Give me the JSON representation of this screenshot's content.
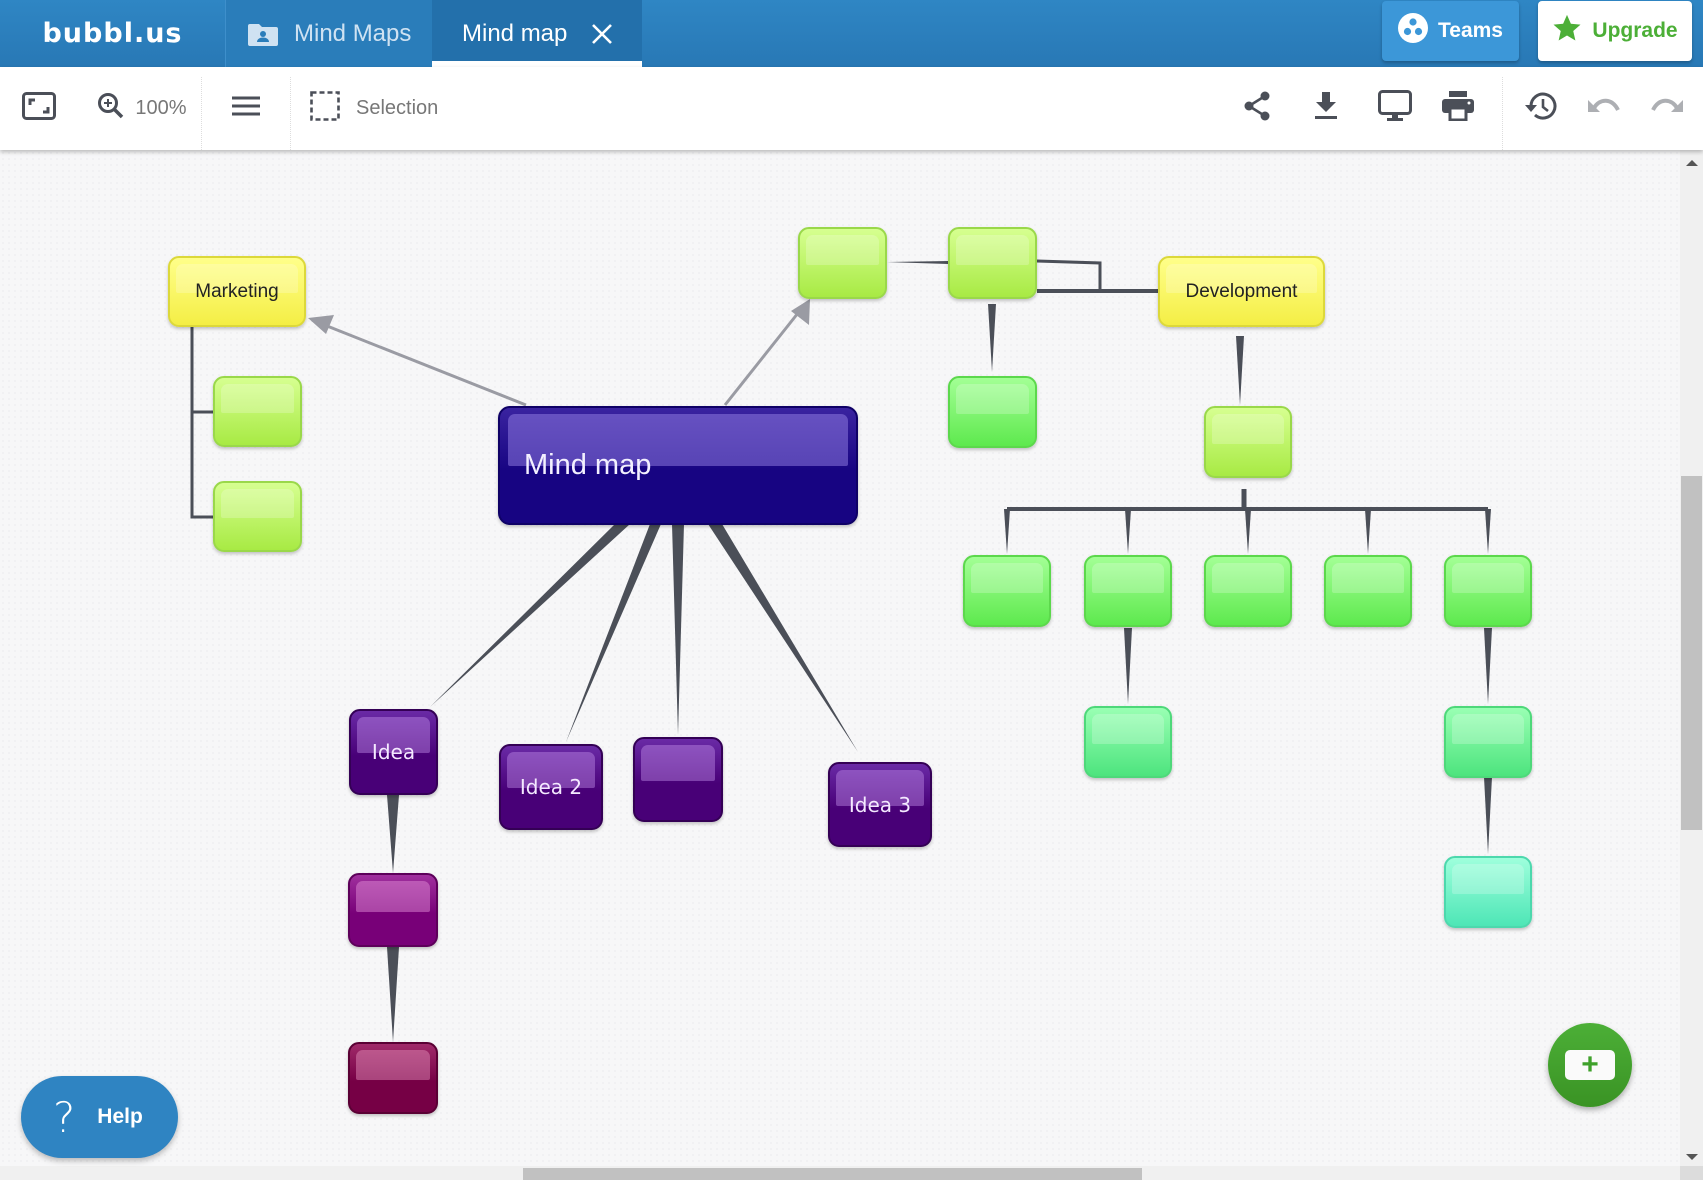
{
  "header": {
    "logo": "bubbl.us",
    "tabs": [
      {
        "label": "Mind Maps",
        "icon": "folder-user-icon",
        "active": false
      },
      {
        "label": "Mind map",
        "icon": "close-icon",
        "active": true
      }
    ],
    "teams_label": "Teams",
    "upgrade_label": "Upgrade"
  },
  "toolbar": {
    "fit_icon": "fit-screen-icon",
    "zoom_level": "100%",
    "menu_icon": "hamburger-menu-icon",
    "selection_label": "Selection",
    "right_icons": [
      "share-icon",
      "download-icon",
      "present-icon",
      "print-icon",
      "history-icon",
      "undo-icon",
      "redo-icon"
    ]
  },
  "mindmap": {
    "root": {
      "label": "Mind map",
      "color": "#170482"
    },
    "nodes": {
      "marketing": {
        "label": "Marketing",
        "color": "#f4ee45"
      },
      "development": {
        "label": "Development",
        "color": "#f4ee45"
      },
      "idea1": {
        "label": "Idea",
        "color": "#480077"
      },
      "idea2": {
        "label": "Idea 2",
        "color": "#480077"
      },
      "idea_blank": {
        "label": "",
        "color": "#480077"
      },
      "idea3": {
        "label": "Idea 3",
        "color": "#480077"
      },
      "idea_child": {
        "label": "",
        "color": "#780078"
      },
      "idea_grandchild": {
        "label": "",
        "color": "#760045"
      }
    },
    "link_color": "#4b4f58",
    "arrow_color": "#9a9ba3"
  },
  "floating": {
    "help_icon": "?",
    "help_label": "Help",
    "add_icon": "+"
  },
  "colors": {
    "header_bg": "#2f86c4",
    "active_tab_bg": "#2370ab",
    "teams_bg": "#3c97d8",
    "upgrade_text": "#4caf37",
    "add_fab": "#4caf37",
    "help_bg": "#2f84c2"
  }
}
